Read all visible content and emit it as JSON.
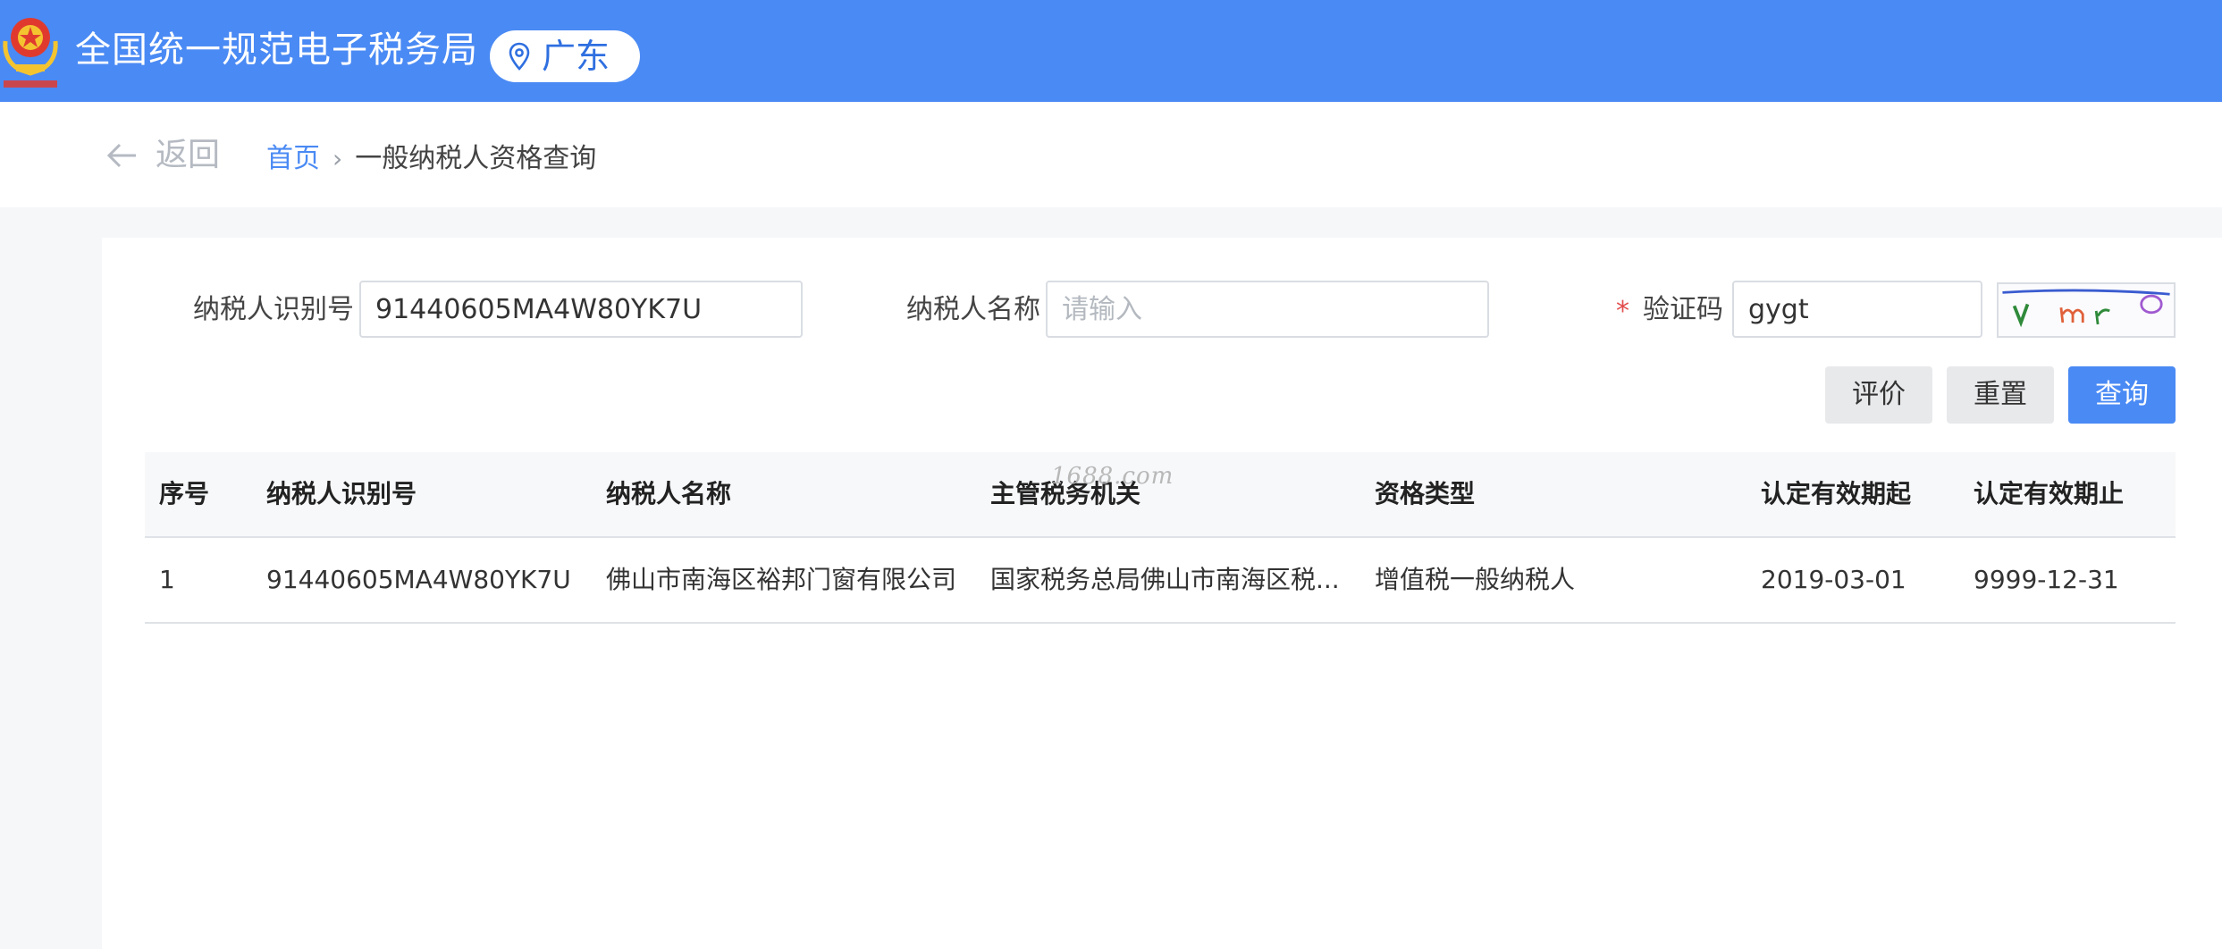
{
  "header": {
    "title": "全国统一规范电子税务局",
    "region": "广东",
    "emblem_icon": "national-emblem-icon",
    "pin_icon": "location-pin-icon",
    "colors": {
      "bar": "#4a8af4",
      "region_text": "#2f6fe0"
    }
  },
  "nav": {
    "back_label": "返回",
    "breadcrumb": {
      "home": "首页",
      "separator": "›",
      "current": "一般纳税人资格查询"
    }
  },
  "form": {
    "taxpayer_id": {
      "label": "纳税人识别号",
      "value": "91440605MA4W80YK7U"
    },
    "taxpayer_name": {
      "label": "纳税人名称",
      "value": "",
      "placeholder": "请输入"
    },
    "captcha": {
      "required_mark": "*",
      "label": "验证码",
      "value": "gygt"
    }
  },
  "buttons": {
    "rate": "评价",
    "reset": "重置",
    "query": "查询"
  },
  "table": {
    "columns": [
      "序号",
      "纳税人识别号",
      "纳税人名称",
      "主管税务机关",
      "资格类型",
      "认定有效期起",
      "认定有效期止"
    ],
    "rows": [
      [
        "1",
        "91440605MA4W80YK7U",
        "佛山市南海区裕邦门窗有限公司",
        "国家税务总局佛山市南海区税...",
        "增值税一般纳税人",
        "2019-03-01",
        "9999-12-31"
      ]
    ]
  },
  "watermark": "1688.com"
}
